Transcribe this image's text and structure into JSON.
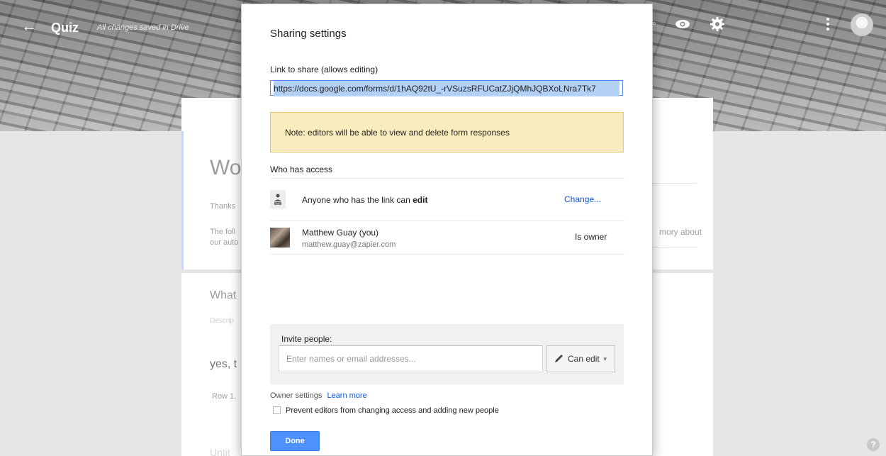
{
  "header": {
    "back_icon": "arrow-left-icon",
    "title": "Quiz",
    "saved_status": "All changes saved in Drive",
    "partial_icon_glyph": "◦"
  },
  "background_form": {
    "title_partial": "Wo",
    "thanks_partial": "Thanks",
    "following_partial_1": "The foll",
    "following_partial_2": "our auto",
    "right_partial": "mory about",
    "question_partial": "What",
    "description_partial": "Descrip",
    "answer_partial": "yes, t",
    "row_partial": "Row 1.",
    "untitled_partial": "Untit"
  },
  "dialog": {
    "title": "Sharing settings",
    "link_label": "Link to share (allows editing)",
    "link_value": "https://docs.google.com/forms/d/1hAQ92tU_-rVSuzsRFUCatZJjQMhJQBXoLNra7Tk7",
    "note": "Note: editors will be able to view and delete form responses",
    "who_has_access": "Who has access",
    "access_entries": {
      "anyone_text": "Anyone who has the link can ",
      "anyone_bold": "edit",
      "change_link": "Change...",
      "owner_name": "Matthew Guay (you)",
      "owner_email": "matthew.guay@zapier.com",
      "owner_role": "Is owner"
    },
    "invite": {
      "label": "Invite people:",
      "placeholder": "Enter names or email addresses...",
      "permission": "Can edit"
    },
    "owner_settings": {
      "label": "Owner settings",
      "learn_more": "Learn more",
      "prevent_label": "Prevent editors from changing access and adding new people",
      "prevent_checked": false
    },
    "done_label": "Done"
  },
  "help_glyph": "?",
  "colors": {
    "accent_blue": "#4d90fe",
    "link_blue": "#1155cc",
    "note_bg": "#f9edbe",
    "note_border": "#f0c36d"
  }
}
